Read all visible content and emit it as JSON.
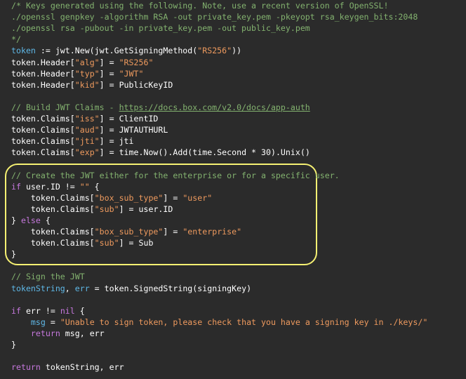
{
  "lines": [
    [
      {
        "t": "/* Keys generated using the following. Note, use a recent version of OpenSSL!",
        "c": "c"
      }
    ],
    [
      {
        "t": "./openssl genpkey -algorithm RSA -out private_key.pem -pkeyopt rsa_keygen_bits:2048",
        "c": "c"
      }
    ],
    [
      {
        "t": "./openssl rsa -pubout -in private_key.pem -out public_key.pem",
        "c": "c"
      }
    ],
    [
      {
        "t": "*/",
        "c": "c"
      }
    ],
    [
      {
        "t": "token",
        "c": "f"
      },
      {
        "t": " := jwt.New(jwt.GetSigningMethod(",
        "c": "w"
      },
      {
        "t": "\"RS256\"",
        "c": "s"
      },
      {
        "t": "))",
        "c": "w"
      }
    ],
    [
      {
        "t": "token.Header[",
        "c": "w"
      },
      {
        "t": "\"alg\"",
        "c": "s"
      },
      {
        "t": "] = ",
        "c": "w"
      },
      {
        "t": "\"RS256\"",
        "c": "s"
      }
    ],
    [
      {
        "t": "token.Header[",
        "c": "w"
      },
      {
        "t": "\"typ\"",
        "c": "s"
      },
      {
        "t": "] = ",
        "c": "w"
      },
      {
        "t": "\"JWT\"",
        "c": "s"
      }
    ],
    [
      {
        "t": "token.Header[",
        "c": "w"
      },
      {
        "t": "\"kid\"",
        "c": "s"
      },
      {
        "t": "] = PublicKeyID",
        "c": "w"
      }
    ],
    [],
    [
      {
        "t": "// Build JWT Claims - ",
        "c": "c"
      },
      {
        "t": "https://docs.box.com/v2.0/docs/app-auth",
        "c": "u"
      }
    ],
    [
      {
        "t": "token.Claims[",
        "c": "w"
      },
      {
        "t": "\"iss\"",
        "c": "s"
      },
      {
        "t": "] = ClientID",
        "c": "w"
      }
    ],
    [
      {
        "t": "token.Claims[",
        "c": "w"
      },
      {
        "t": "\"aud\"",
        "c": "s"
      },
      {
        "t": "] = JWTAUTHURL",
        "c": "w"
      }
    ],
    [
      {
        "t": "token.Claims[",
        "c": "w"
      },
      {
        "t": "\"jti\"",
        "c": "s"
      },
      {
        "t": "] = jti",
        "c": "w"
      }
    ],
    [
      {
        "t": "token.Claims[",
        "c": "w"
      },
      {
        "t": "\"exp\"",
        "c": "s"
      },
      {
        "t": "] = time.Now().Add(time.Second * ",
        "c": "w"
      },
      {
        "t": "30",
        "c": "num"
      },
      {
        "t": ").Unix()",
        "c": "w"
      }
    ],
    [],
    [
      {
        "t": "// Create the JWT either for the enterprise or for a specific user.",
        "c": "c"
      }
    ],
    [
      {
        "t": "if",
        "c": "k"
      },
      {
        "t": " user.ID != ",
        "c": "w"
      },
      {
        "t": "\"\"",
        "c": "s"
      },
      {
        "t": " {",
        "c": "w"
      }
    ],
    [
      {
        "t": "    token.Claims[",
        "c": "w"
      },
      {
        "t": "\"box_sub_type\"",
        "c": "s"
      },
      {
        "t": "] = ",
        "c": "w"
      },
      {
        "t": "\"user\"",
        "c": "s"
      }
    ],
    [
      {
        "t": "    token.Claims[",
        "c": "w"
      },
      {
        "t": "\"sub\"",
        "c": "s"
      },
      {
        "t": "] = user.ID",
        "c": "w"
      }
    ],
    [
      {
        "t": "} ",
        "c": "w"
      },
      {
        "t": "else",
        "c": "k"
      },
      {
        "t": " {",
        "c": "w"
      }
    ],
    [
      {
        "t": "    token.Claims[",
        "c": "w"
      },
      {
        "t": "\"box_sub_type\"",
        "c": "s"
      },
      {
        "t": "] = ",
        "c": "w"
      },
      {
        "t": "\"enterprise\"",
        "c": "s"
      }
    ],
    [
      {
        "t": "    token.Claims[",
        "c": "w"
      },
      {
        "t": "\"sub\"",
        "c": "s"
      },
      {
        "t": "] = Sub",
        "c": "w"
      }
    ],
    [
      {
        "t": "}",
        "c": "w"
      }
    ],
    [],
    [
      {
        "t": "// Sign the JWT",
        "c": "c"
      }
    ],
    [
      {
        "t": "tokenString",
        "c": "f"
      },
      {
        "t": ", ",
        "c": "w"
      },
      {
        "t": "err",
        "c": "f"
      },
      {
        "t": " = token.SignedString(signingKey)",
        "c": "w"
      }
    ],
    [],
    [
      {
        "t": "if",
        "c": "k"
      },
      {
        "t": " err != ",
        "c": "w"
      },
      {
        "t": "nil",
        "c": "k"
      },
      {
        "t": " {",
        "c": "w"
      }
    ],
    [
      {
        "t": "    ",
        "c": "w"
      },
      {
        "t": "msg",
        "c": "f"
      },
      {
        "t": " = ",
        "c": "w"
      },
      {
        "t": "\"Unable to sign token, please check that you have a signing key in ./keys/\"",
        "c": "s"
      }
    ],
    [
      {
        "t": "    ",
        "c": "w"
      },
      {
        "t": "return",
        "c": "k"
      },
      {
        "t": " msg, err",
        "c": "w"
      }
    ],
    [
      {
        "t": "}",
        "c": "w"
      }
    ],
    [],
    [
      {
        "t": "return",
        "c": "k"
      },
      {
        "t": " tokenString, err",
        "c": "w"
      }
    ]
  ]
}
